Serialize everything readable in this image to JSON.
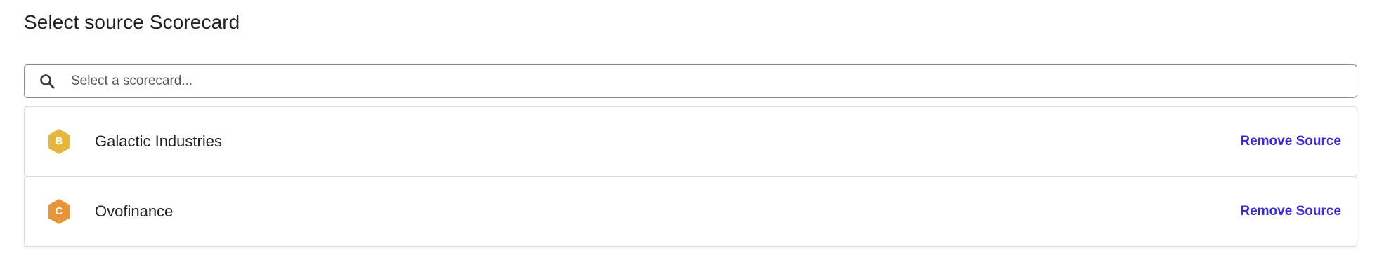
{
  "header": {
    "title": "Select source Scorecard"
  },
  "search": {
    "placeholder": "Select a scorecard...",
    "value": ""
  },
  "sources": [
    {
      "grade": "B",
      "grade_color": "#E3B83C",
      "name": "Galactic Industries",
      "action_label": "Remove Source"
    },
    {
      "grade": "C",
      "grade_color": "#E8953A",
      "name": "Ovofinance",
      "action_label": "Remove Source"
    }
  ],
  "colors": {
    "link": "#3A2AD1",
    "border": "#DADCE0",
    "text": "#1F2125"
  }
}
